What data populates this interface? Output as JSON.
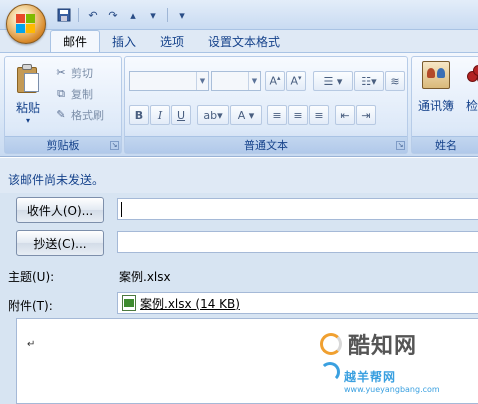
{
  "tabs": [
    "邮件",
    "插入",
    "选项",
    "设置文本格式"
  ],
  "clipboard": {
    "paste": "粘贴",
    "cut": "剪切",
    "copy": "复制",
    "format_painter": "格式刷",
    "group_label": "剪贴板"
  },
  "basic_text": {
    "group_label": "普通文本"
  },
  "names": {
    "group_label": "姓名",
    "address_book": "通讯簿",
    "check": "检查"
  },
  "message": {
    "not_sent": "该邮件尚未发送。",
    "to_button": "收件人(O)...",
    "cc_button": "抄送(C)...",
    "subject_label": "主题(U):",
    "subject_value": "案例.xlsx",
    "attach_label": "附件(T):",
    "attachment": "案例.xlsx (14 KB)"
  },
  "watermark": {
    "brand": "酷知网",
    "brand2": "越羊帮网",
    "url": "www.yueyangbang.com"
  },
  "colors": {
    "ribbon": "#dbe8f7",
    "accent": "#15428b",
    "office_orange": "#d98a2b"
  }
}
